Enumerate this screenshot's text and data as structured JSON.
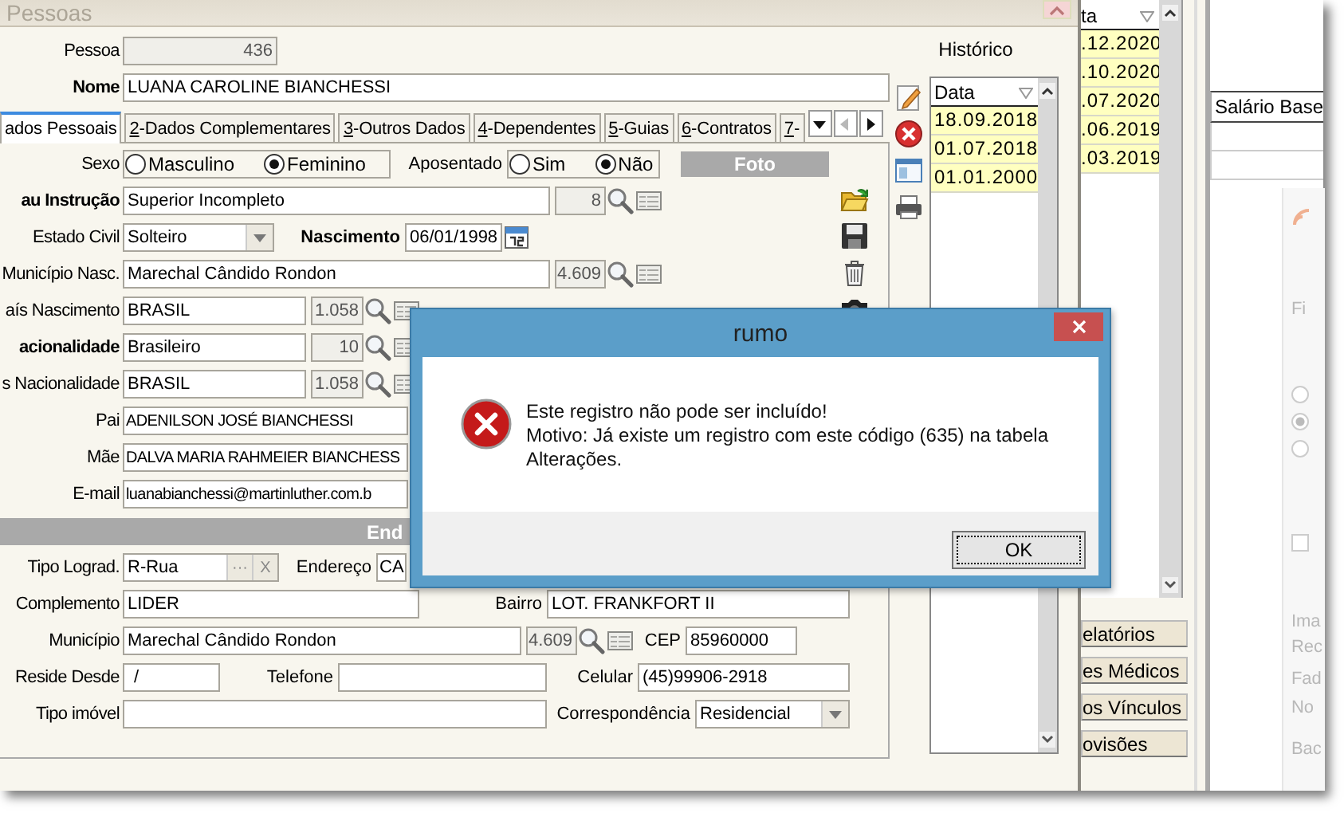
{
  "main_window": {
    "title": "Pessoas",
    "pessoa": {
      "label": "Pessoa",
      "value": "436"
    },
    "nome": {
      "label": "Nome",
      "value": "LUANA CAROLINE BIANCHESSI"
    },
    "tabs": [
      {
        "label": "ados Pessoais",
        "selected": true
      },
      {
        "key": "2",
        "label": "-Dados Complementares",
        "selected": false
      },
      {
        "key": "3",
        "label": "-Outros Dados",
        "selected": false
      },
      {
        "key": "4",
        "label": "-Dependentes",
        "selected": false
      },
      {
        "key": "5",
        "label": "-Guias",
        "selected": false
      },
      {
        "key": "6",
        "label": "-Contratos",
        "selected": false
      },
      {
        "key": "7",
        "label": "-",
        "selected": false
      }
    ],
    "tab_scroll": {
      "left_disabled": true
    },
    "sexo": {
      "label": "Sexo",
      "options": [
        {
          "label": "Masculino",
          "selected": false
        },
        {
          "label": "Feminino",
          "selected": true
        }
      ]
    },
    "aposentado": {
      "label": "Aposentado",
      "options": [
        {
          "label": "Sim",
          "selected": false
        },
        {
          "label": "Não",
          "selected": true
        }
      ]
    },
    "foto": {
      "label": "Foto"
    },
    "fields": [
      {
        "kind": "lookup_wide",
        "label": "au Instrução",
        "bold": true,
        "value": "Superior Incompleto",
        "code": "8"
      },
      {
        "kind": "combo_date",
        "label": "Estado Civil",
        "bold": false,
        "value": "Solteiro",
        "date_label": "Nascimento",
        "date": "06/01/1998"
      },
      {
        "kind": "lookup_wide",
        "label": "Município Nasc.",
        "bold": false,
        "value": "Marechal Cândido Rondon",
        "code": "4.609"
      },
      {
        "kind": "lookup",
        "label": "aís Nascimento",
        "bold": false,
        "value": "BRASIL",
        "code": "1.058"
      },
      {
        "kind": "lookup",
        "label": "acionalidade",
        "bold": true,
        "value": "Brasileiro",
        "code": "10"
      },
      {
        "kind": "lookup",
        "label": "s Nacionalidade",
        "bold": false,
        "value": "BRASIL",
        "code": "1.058"
      },
      {
        "kind": "text",
        "label": "Pai",
        "bold": false,
        "value": "ADENILSON JOSÉ BIANCHESSI"
      },
      {
        "kind": "text",
        "label": "Mãe",
        "bold": false,
        "value": "DALVA MARIA RAHMEIER BIANCHESS"
      },
      {
        "kind": "text",
        "label": "E-mail",
        "bold": false,
        "value": "luanabianchessi@martinluther.com.b"
      }
    ],
    "section_title": "End",
    "address": {
      "tipo_lograd": {
        "label": "Tipo Lograd.",
        "value": "R-Rua",
        "browse": "···",
        "clear": "X"
      },
      "endereco": {
        "label": "Endereço",
        "value": "CA"
      },
      "complemento": {
        "label": "Complemento",
        "value": "LIDER"
      },
      "bairro": {
        "label": "Bairro",
        "value": "LOT. FRANKFORT II"
      },
      "municipio": {
        "label": "Município",
        "value": "Marechal Cândido Rondon",
        "code": "4.609"
      },
      "cep": {
        "label": "CEP",
        "value": "85960000"
      },
      "reside_desde": {
        "label": "Reside Desde",
        "value": "/"
      },
      "telefone": {
        "label": "Telefone"
      },
      "celular": {
        "label": "Celular",
        "value": "(45)99906-2918"
      },
      "tipo_imovel": {
        "label": "Tipo imóvel"
      },
      "correspondencia": {
        "label": "Correspondência",
        "value": "Residencial"
      }
    },
    "historico": {
      "title": "Histórico",
      "column": "Data",
      "rows": [
        "18.09.2018",
        "01.07.2018",
        "01.01.2000"
      ]
    }
  },
  "dialog": {
    "title": "rumo",
    "heading": "Este registro não pode ser incluído!",
    "message": "Motivo: Já existe um registro com este código (635) na tabela Alterações.",
    "button": "OK"
  },
  "background_window": {
    "date_column": "ta",
    "dates": [
      ".12.2020",
      ".10.2020",
      ".07.2020",
      ".06.2019",
      ".03.2019"
    ],
    "buttons": [
      "elatórios",
      "es Médicos",
      "os Vínculos",
      "ovisões"
    ],
    "table_column": "Salário Base",
    "faded_panel": {
      "labels": [
        "Fi",
        "Ima",
        "Rec",
        "Fad",
        "No",
        "Bac"
      ],
      "options": [
        {
          "selected": false
        },
        {
          "selected": true
        },
        {
          "selected": false
        }
      ],
      "checkbox": {
        "checked": false
      }
    }
  }
}
